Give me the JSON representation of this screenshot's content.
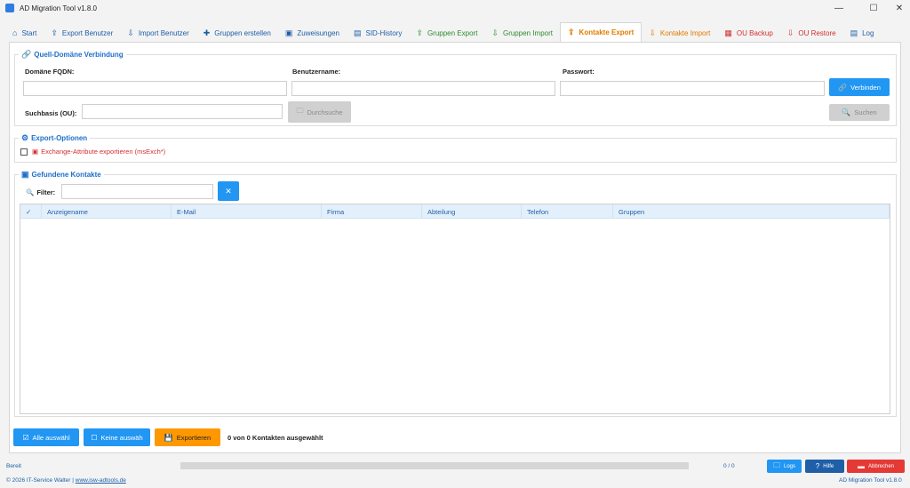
{
  "window": {
    "title": "AD Migration Tool v1.8.0",
    "minimize": "—",
    "maximize": "☐",
    "close": "✕"
  },
  "tabs": [
    {
      "label": "Start",
      "icon": "home-icon",
      "glyph": "⌂",
      "color": "#1e5fa8"
    },
    {
      "label": "Export Benutzer",
      "icon": "export-user-icon",
      "glyph": "⇪",
      "color": "#1e5fa8"
    },
    {
      "label": "Import Benutzer",
      "icon": "import-user-icon",
      "glyph": "⇩",
      "color": "#1e5fa8"
    },
    {
      "label": "Gruppen erstellen",
      "icon": "plus-icon",
      "glyph": "✚",
      "color": "#1e5fa8"
    },
    {
      "label": "Zuweisungen",
      "icon": "assign-icon",
      "glyph": "▣",
      "color": "#1e5fa8"
    },
    {
      "label": "SID-History",
      "icon": "sid-icon",
      "glyph": "▤",
      "color": "#1e5fa8"
    },
    {
      "label": "Gruppen Export",
      "icon": "group-export-icon",
      "glyph": "⇪",
      "color": "#2e8b2e"
    },
    {
      "label": "Gruppen Import",
      "icon": "group-import-icon",
      "glyph": "⇩",
      "color": "#2e8b2e"
    },
    {
      "label": "Kontakte Export",
      "icon": "contact-export-icon",
      "glyph": "⇪",
      "color": "#e07b00"
    },
    {
      "label": "Kontakte Import",
      "icon": "contact-import-icon",
      "glyph": "⇩",
      "color": "#e07b00"
    },
    {
      "label": "OU Backup",
      "icon": "backup-icon",
      "glyph": "▦",
      "color": "#d32f2f"
    },
    {
      "label": "OU Restore",
      "icon": "restore-icon",
      "glyph": "⇩",
      "color": "#d32f2f"
    },
    {
      "label": "Log",
      "icon": "log-icon",
      "glyph": "▤",
      "color": "#1e5fa8"
    }
  ],
  "active_tab": 8,
  "source": {
    "title": "Quell-Domäne Verbindung",
    "domain_label": "Domäne FQDN:",
    "user_label": "Benutzername:",
    "password_label": "Passwort:",
    "connect_label": "Verbinden",
    "searchbase_label": "Suchbasis (OU):",
    "browse_label": "Durchsuche",
    "search_label": "Suchen",
    "domain_value": "",
    "user_value": "",
    "password_value": "",
    "searchbase_value": ""
  },
  "options": {
    "title": "Export-Optionen",
    "exchange_label": "Exchange-Attribute exportieren (msExch*)"
  },
  "contacts": {
    "title": "Gefundene Kontakte",
    "filter_label": "Filter:",
    "filter_value": "",
    "clear_label": "✕",
    "columns": [
      "✓",
      "Anzeigename",
      "E-Mail",
      "Firma",
      "Abteilung",
      "Telefon",
      "Gruppen"
    ]
  },
  "actions": {
    "select_all": "Alle auswähl",
    "select_none": "Keine auswäh",
    "export": "Exportieren",
    "selection_status": "0 von 0 Kontakten ausgewählt"
  },
  "status": {
    "text": "Bereit",
    "progress": 0,
    "counter": "0 / 0",
    "logs_label": "Logs",
    "help_label": "Hilfe",
    "cancel_label": "Abbrechen",
    "copyright": "© 2026 IT-Service Walter |",
    "website": "www.isw-adtools.de",
    "version": "AD Migration Tool v1.8.0"
  },
  "colors": {
    "accent": "#2196f3",
    "active_tab": "#e07b00",
    "export": "#ff9800",
    "cancel": "#e53935",
    "group_title": "#1e6fc8"
  }
}
